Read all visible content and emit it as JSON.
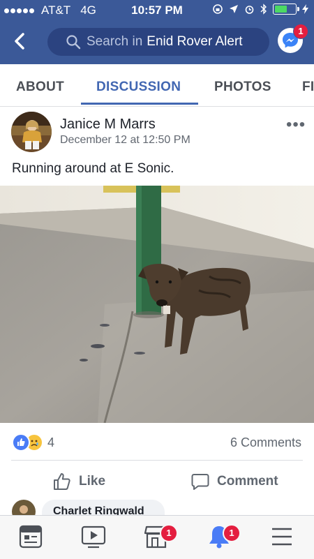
{
  "status_bar": {
    "carrier": "AT&T",
    "network": "4G",
    "time": "10:57 PM",
    "battery_level": 0.65
  },
  "navbar": {
    "search_prefix": "Search in",
    "search_group": "Enid Rover Alert",
    "messenger_badge": "1"
  },
  "tabs": [
    {
      "label": "ABOUT"
    },
    {
      "label": "DISCUSSION",
      "active": true
    },
    {
      "label": "PHOTOS"
    },
    {
      "label": "FI"
    }
  ],
  "post": {
    "author": "Janice M Marrs",
    "date": "December 12 at 12:50 PM",
    "text": "Running around at E Sonic.",
    "reaction_count": "4",
    "comments": "6 Comments",
    "like_label": "Like",
    "comment_label": "Comment",
    "first_commenter": "Charlet Ringwald"
  },
  "bottom_bar": {
    "marketplace_badge": "1",
    "notifications_badge": "1"
  },
  "colors": {
    "brand_blue": "#3b5998",
    "active_tab": "#4267b2",
    "badge_red": "#e41e3f"
  },
  "icons": [
    "back-chevron-icon",
    "search-icon",
    "messenger-icon",
    "more-icon",
    "like-reaction-icon",
    "sad-reaction-icon",
    "thumbs-up-icon",
    "comment-icon",
    "news-feed-icon",
    "watch-icon",
    "marketplace-icon",
    "notifications-bell-icon",
    "menu-icon"
  ]
}
